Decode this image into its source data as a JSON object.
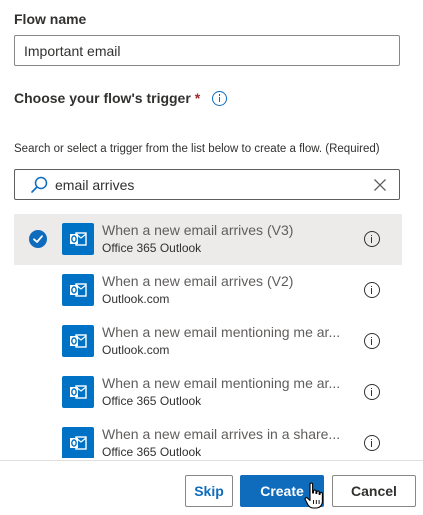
{
  "flow_name": {
    "label": "Flow name",
    "value": "Important email"
  },
  "trigger": {
    "label": "Choose your flow's trigger",
    "required_mark": "*",
    "info_icon": "info-icon",
    "helper_text": "Search or select a trigger from the list below to create a flow. (Required)",
    "search_value": "email arrives"
  },
  "triggers": [
    {
      "title": "When a new email arrives (V3)",
      "connector": "Office 365 Outlook",
      "selected": true
    },
    {
      "title": "When a new email arrives (V2)",
      "connector": "Outlook.com",
      "selected": false
    },
    {
      "title": "When a new email mentioning me ar...",
      "connector": "Outlook.com",
      "selected": false
    },
    {
      "title": "When a new email mentioning me ar...",
      "connector": "Office 365 Outlook",
      "selected": false
    },
    {
      "title": "When a new email arrives in a share...",
      "connector": "Office 365 Outlook",
      "selected": false
    }
  ],
  "footer": {
    "skip_label": "Skip",
    "create_label": "Create",
    "cancel_label": "Cancel"
  },
  "colors": {
    "accent": "#0f6cbd",
    "outlook": "#0072c6",
    "selected_row": "#edebe9",
    "required": "#a4262c"
  }
}
